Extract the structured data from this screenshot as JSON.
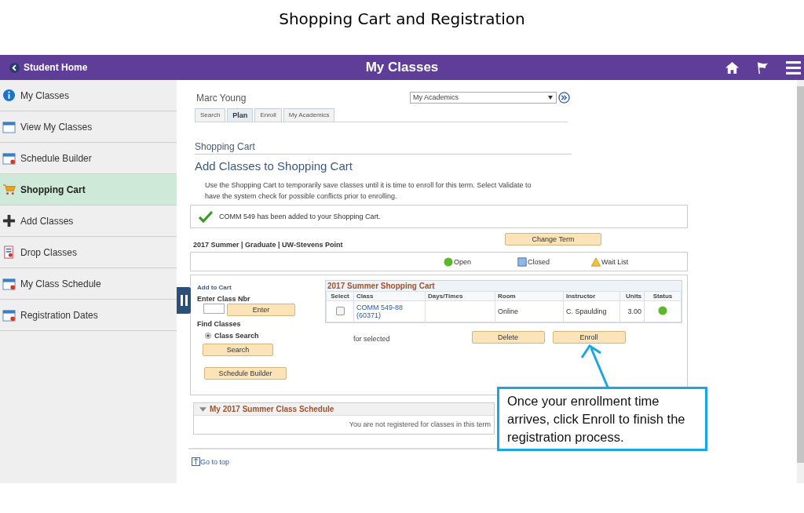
{
  "slide_title": "Shopping Cart and Registration",
  "header": {
    "back_label": "Student Home",
    "title": "My Classes"
  },
  "sidebar": {
    "items": [
      {
        "label": "My Classes",
        "selected": false
      },
      {
        "label": "View My Classes",
        "selected": false
      },
      {
        "label": "Schedule Builder",
        "selected": false
      },
      {
        "label": "Shopping Cart",
        "selected": true
      },
      {
        "label": "Add Classes",
        "selected": false
      },
      {
        "label": "Drop Classes",
        "selected": false
      },
      {
        "label": "My Class Schedule",
        "selected": false
      },
      {
        "label": "Registration Dates",
        "selected": false
      }
    ]
  },
  "student_name": "Marc Young",
  "nav_select": {
    "value": "My Academics"
  },
  "tabs": [
    {
      "label": "Search",
      "selected": false
    },
    {
      "label": "Plan",
      "selected": true
    },
    {
      "label": "Enroll",
      "selected": false
    },
    {
      "label": "My Academics",
      "selected": false
    }
  ],
  "section_title": "Shopping Cart",
  "page_heading": "Add Classes to Shopping Cart",
  "instructions": "Use the Shopping Cart to temporarily save classes until it is time to enroll for this term.  Select Validate to have the system check for possible conflicts prior to enrolling.",
  "message": "COMM  549 has been added to your Shopping Cart.",
  "term": "2017 Summer | Graduate | UW-Stevens Point",
  "change_term_button": "Change Term",
  "legend": [
    {
      "kind": "open",
      "label": "Open"
    },
    {
      "kind": "closed",
      "label": "Closed"
    },
    {
      "kind": "waitlist",
      "label": "Wait List"
    }
  ],
  "add_to_cart": {
    "title": "Add to Cart",
    "class_nbr_label": "Enter Class Nbr",
    "enter_button": "Enter",
    "find_title": "Find Classes",
    "options": [
      {
        "label": "Class Search",
        "selected": true
      }
    ],
    "search_button": "Search",
    "schedule_builder_button": "Schedule Builder"
  },
  "cart": {
    "title": "2017 Summer Shopping Cart",
    "columns": [
      "Select",
      "Class",
      "Days/Times",
      "Room",
      "Instructor",
      "Units",
      "Status"
    ],
    "rows": [
      {
        "checked": false,
        "class": "COMM 549-88 (60371)",
        "room": "Online",
        "instructor": "C. Spaulding",
        "units": "3.00",
        "open": true
      }
    ],
    "for_selected": "for selected",
    "delete_button": "Delete",
    "enroll_button": "Enroll"
  },
  "schedule": {
    "title": "My 2017 Summer Class Schedule",
    "expanded": true,
    "message": "You are not registered for classes in this term"
  },
  "go_to_top": "Go to top",
  "callout": "Once your enrollment time arrives, click Enroll to finish the registration process."
}
